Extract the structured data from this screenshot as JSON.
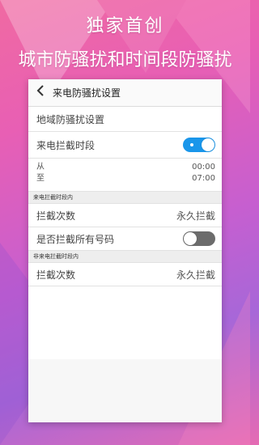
{
  "promo": {
    "line1": "独家首创",
    "line2": "城市防骚扰和时间段防骚扰"
  },
  "screen": {
    "title": "来电防骚扰设置",
    "back_icon": "chevron-left-icon",
    "region_label": "地域防骚扰设置",
    "time_period_label": "来电拦截时段",
    "time_period_on": true,
    "from_label": "从",
    "from_time": "00:00",
    "to_label": "至",
    "to_time": "07:00",
    "in_period_header": "来电拦截时段内",
    "in_count_label": "拦截次数",
    "in_count_value": "永久拦截",
    "block_all_label": "是否拦截所有号码",
    "block_all_on": false,
    "out_period_header": "非来电拦截时段内",
    "out_count_label": "拦截次数",
    "out_count_value": "永久拦截"
  },
  "colors": {
    "accent": "#1a96ea",
    "toggle_off": "#6c6c6c"
  }
}
